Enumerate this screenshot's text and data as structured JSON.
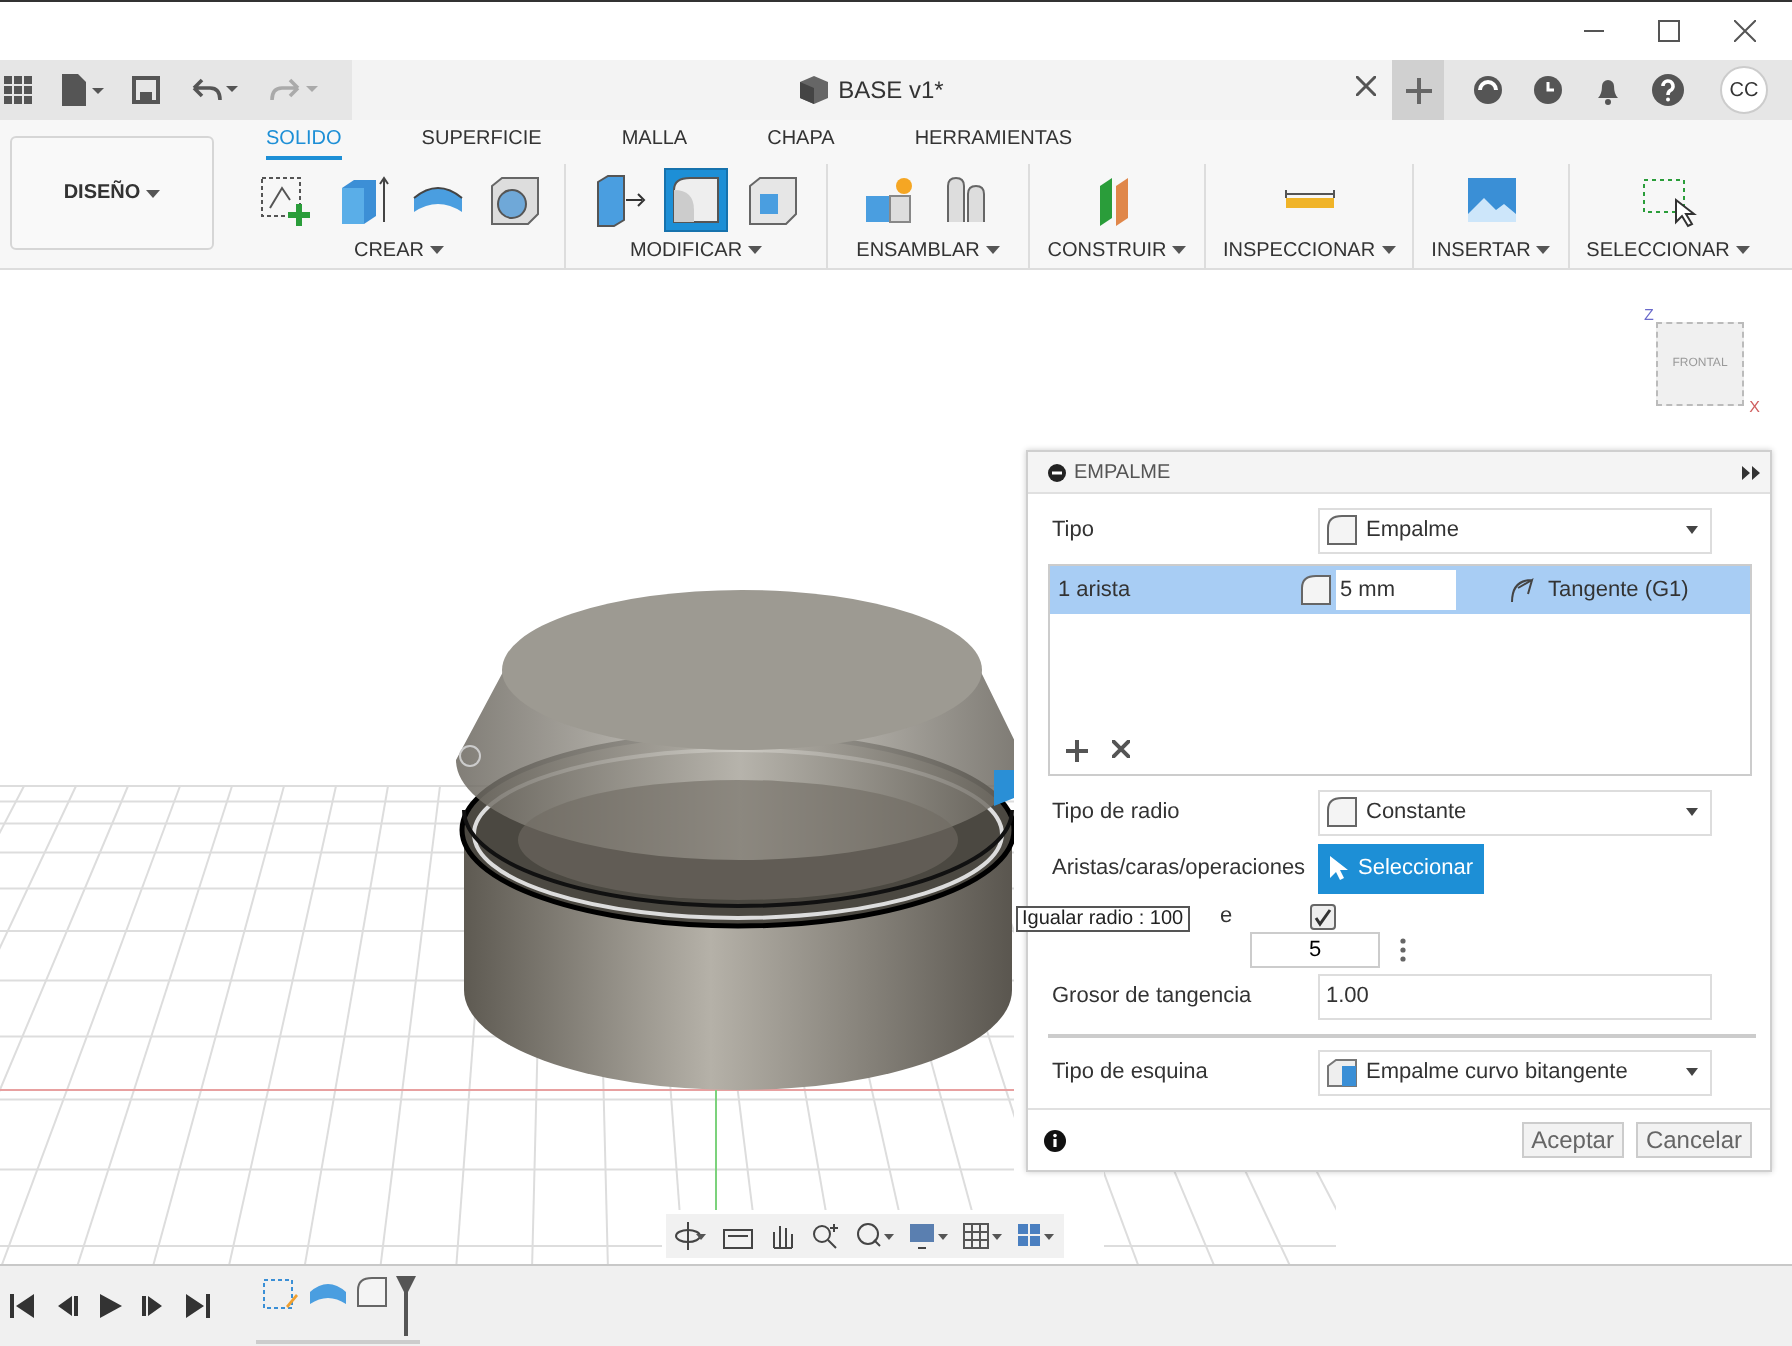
{
  "window": {
    "tab_title": "BASE v1*",
    "user_initials": "CC"
  },
  "workspace": {
    "label": "DISEÑO"
  },
  "ribbon_tabs": [
    {
      "label": "SOLIDO",
      "selected": true
    },
    {
      "label": "SUPERFICIE",
      "selected": false
    },
    {
      "label": "MALLA",
      "selected": false
    },
    {
      "label": "CHAPA",
      "selected": false
    },
    {
      "label": "HERRAMIENTAS",
      "selected": false
    }
  ],
  "tool_groups": [
    {
      "label": "CREAR",
      "tools": [
        {
          "kind": "sketch",
          "selected": false
        },
        {
          "kind": "extrude",
          "selected": false
        },
        {
          "kind": "revolve",
          "selected": false
        },
        {
          "kind": "hole",
          "selected": false
        }
      ]
    },
    {
      "label": "MODIFICAR",
      "tools": [
        {
          "kind": "presspull",
          "selected": false
        },
        {
          "kind": "fillet",
          "selected": true
        },
        {
          "kind": "shell",
          "selected": false
        }
      ]
    },
    {
      "label": "ENSAMBLAR",
      "tools": [
        {
          "kind": "component",
          "selected": false
        },
        {
          "kind": "joint",
          "selected": false
        }
      ]
    },
    {
      "label": "CONSTRUIR",
      "tools": [
        {
          "kind": "plane",
          "selected": false
        }
      ]
    },
    {
      "label": "INSPECCIONAR",
      "tools": [
        {
          "kind": "measure",
          "selected": false
        }
      ]
    },
    {
      "label": "INSERTAR",
      "tools": [
        {
          "kind": "image",
          "selected": false
        }
      ]
    },
    {
      "label": "SELECCIONAR",
      "tools": [
        {
          "kind": "select",
          "selected": false
        }
      ]
    }
  ],
  "view_cube": {
    "face": "FRONTAL",
    "axis_z": "Z",
    "axis_x": "X"
  },
  "fillet_panel": {
    "title": "EMPALME",
    "rows": [
      {
        "kind": "dropdown",
        "label": "Tipo",
        "value": "Empalme"
      },
      {
        "kind": "selection_list",
        "items": [
          {
            "name": "1 arista",
            "radius": "5 mm",
            "continuity": "Tangente (G1)",
            "selected": true
          }
        ]
      },
      {
        "kind": "dropdown",
        "label": "Tipo de radio",
        "value": "Constante"
      },
      {
        "kind": "select_button",
        "label": "Aristas/caras/operaciones",
        "button": "Seleccionar"
      },
      {
        "kind": "checkbox",
        "label": "e",
        "checked": true
      },
      {
        "kind": "spinner",
        "value": "5"
      },
      {
        "kind": "input",
        "label": "Grosor de tangencia",
        "value": "1.00"
      },
      {
        "kind": "divider"
      },
      {
        "kind": "dropdown",
        "label": "Tipo de esquina",
        "value": "Empalme curvo bitangente"
      }
    ],
    "buttons": [
      {
        "label": "Aceptar"
      },
      {
        "label": "Cancelar"
      }
    ]
  },
  "tooltip": "Igualar radio : 100",
  "timeline": {
    "features": [
      {
        "kind": "sketch"
      },
      {
        "kind": "revolve"
      },
      {
        "kind": "fillet"
      }
    ]
  }
}
